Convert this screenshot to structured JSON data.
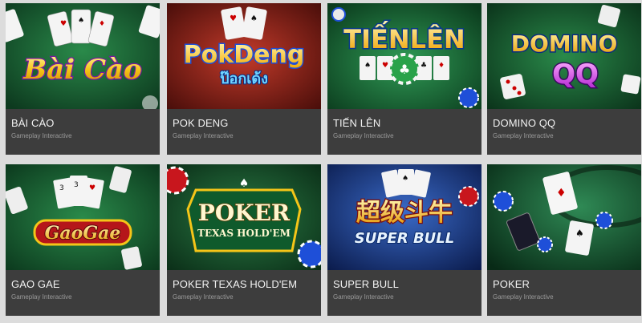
{
  "games": [
    {
      "title": "BÀI CÀO",
      "subtitle": "Gameplay Interactive",
      "logo_text": "Bài Cào",
      "icon": "cards-icon"
    },
    {
      "title": "POK DENG",
      "subtitle": "Gameplay Interactive",
      "logo_text": "PokDeng",
      "logo_sub": "ป๊อกเด้ง",
      "icon": "cards-icon"
    },
    {
      "title": "TIẾN LÊN",
      "subtitle": "Gameplay Interactive",
      "logo_text": "TIẾNLÊN",
      "icon": "cards-chip-icon"
    },
    {
      "title": "DOMINO QQ",
      "subtitle": "Gameplay Interactive",
      "logo_text": "DOMINO",
      "logo_sub": "QQ",
      "icon": "domino-dice-icon"
    },
    {
      "title": "GAO GAE",
      "subtitle": "Gameplay Interactive",
      "logo_text": "GaoGae",
      "icon": "cards-icon"
    },
    {
      "title": "POKER TEXAS HOLD'EM",
      "subtitle": "Gameplay Interactive",
      "logo_text": "POKER",
      "logo_sub": "TEXAS HOLD'EM",
      "icon": "poker-chips-icon"
    },
    {
      "title": "SUPER BULL",
      "subtitle": "Gameplay Interactive",
      "logo_text": "超级斗牛",
      "logo_sub": "SUPER BULL",
      "icon": "cards-icon"
    },
    {
      "title": "POKER",
      "subtitle": "Gameplay Interactive",
      "icon": "poker-table-icon"
    }
  ],
  "colors": {
    "card_bg": "#3a3a3a",
    "page_bg": "#dcdcdc",
    "title_text": "#f2f2f2",
    "subtitle_text": "#9a9a9a",
    "felt_green": "#1f6b3a",
    "logo_gold": "#f5c518",
    "logo_blue": "#1e4fd8",
    "logo_purple": "#a020c8"
  }
}
